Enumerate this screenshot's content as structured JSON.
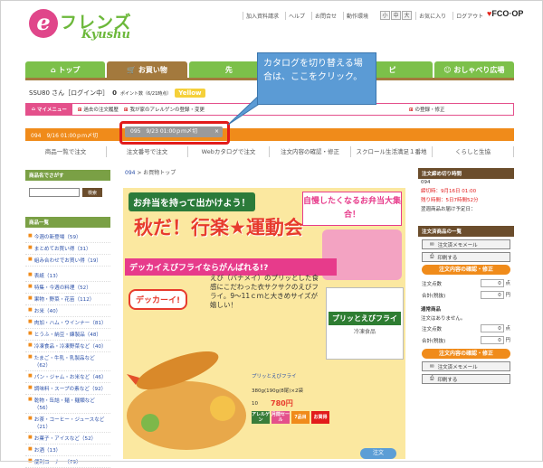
{
  "header": {
    "logo_e": "e",
    "logo_friends": "フレンズ",
    "logo_region": "Kyushu",
    "links": [
      "加入資料請求",
      "ヘルプ",
      "お問合せ",
      "動作環境"
    ],
    "font_sizes": [
      "小",
      "中",
      "大"
    ],
    "favorites": "お気に入り",
    "logout": "ログアウト",
    "coop_heart": "♥",
    "coop": "FCO·OP"
  },
  "nav": {
    "tabs": [
      {
        "label": "トップ",
        "icon": "house-icon"
      },
      {
        "label": "お買い物",
        "icon": "cart-icon"
      },
      {
        "label": "先",
        "icon": "runner-icon"
      },
      {
        "label": "",
        "icon": ""
      },
      {
        "label": "ピ",
        "icon": ""
      },
      {
        "label": "おしゃべり広場",
        "icon": "chat-icon"
      }
    ]
  },
  "status": {
    "user": "SSU80 さん［ログイン中］",
    "points": "0",
    "points_note": "ポイント数（6/21時点）",
    "badge": "Yellow"
  },
  "mypage": {
    "label": "マイメニュー",
    "items": [
      "過去の注文履歴",
      "我が家のアレルゲンの登録・変更",
      "の登録・修正"
    ]
  },
  "order_tabs": {
    "tab1": "094　9/16 01:00ｐｍ〆切",
    "tab2": "095　9/23 01:00ｐｍ〆切",
    "tab2_close": "×"
  },
  "submenu": [
    "商品一覧で注文",
    "注文番号で注文",
    "Webカタログで注文",
    "注文内容の確認・修正",
    "スクロール生活満足１番地",
    "くらしと生協"
  ],
  "callout": "カタログを切り替える場合は、ここをクリック。",
  "left": {
    "search_header": "商品名でさがす",
    "search_button": "検索",
    "search_placeholder": "",
    "list_header": "商品一覧",
    "categories": [
      "今週の新登場（59）",
      "まとめてお買い得（31）",
      "組み合わせでお買い得（19）",
      "表紙（13）",
      "特集・今週の料理（52）",
      "果物・野菜・花苗（112）",
      "お米（40）",
      "肉加・ハム・ウインナー（81）",
      "とうふ・納豆・練製品（48）",
      "冷凍食品・冷凍野菜など（40）",
      "たまご・牛乳・乳製品など（62）",
      "パン・ジャム・お米など（46）",
      "調味料・スープの素など（92）",
      "乾物・缶詰・麺・麺類など（56）",
      "お茶・コーヒー・ジュースなど（21）",
      "お菓子・アイスなど（52）",
      "お酒（13）",
      "便利コーナー（79）"
    ]
  },
  "center": {
    "crumb_num": "094",
    "crumb_rest": "> お買物トップ",
    "banner_title": "お弁当を持って出かけよう！",
    "banner_main": "秋だ！行楽★運動会",
    "banner_sub": "自慢したくなるお弁当大集合！",
    "ribbon": "デッカイえびフライならがんばれる!?",
    "dekkai": "デッカーイ!",
    "desc": "えび（バナメイ）のプリッとした食感にこだわった衣サクサクのえびフライ。9～11ｃｍと大きめサイズが嬉しい！",
    "pack_title": "プリッとえびフライ",
    "pack_sub": "冷凍食品",
    "product_name": "プリッとえびフライ",
    "product_size": "380g(190g(8尾)×2袋",
    "product_code": "10",
    "product_price": "780円",
    "tags": [
      "アレルゲン",
      "月間セール",
      "7品目",
      "お買得"
    ],
    "add_button": "注文"
  },
  "right": {
    "deadline_header": "注文締め切り時間",
    "round": "094",
    "deadline": "締切時：9月16日 01:00",
    "remaining": "残り時間：5日7時間52分",
    "delivery": "翌週商品お届け予定日：",
    "list_header": "注文済商品の一覧",
    "mail_button": "注文済メモメール",
    "print_button": "印刷する",
    "confirm_button": "注文内容の確認・修正",
    "count_label": "注文点数",
    "count_value": "0",
    "count_unit": "点",
    "total_label": "合計(税抜)",
    "total_value": "0",
    "total_unit": "円",
    "regular_label": "通常商品",
    "regular_note": "注文はありません。",
    "count2_label": "注文点数",
    "count2_value": "0",
    "total2_label": "合計(税抜)",
    "total2_value": "0",
    "confirm_button2": "注文内容の確認・修正",
    "mail_button2": "注文済メモメール",
    "print_button2": "印刷する"
  },
  "colors": {
    "brand_green": "#7cc04a",
    "accent_pink": "#e4508b",
    "order_orange": "#f08b1a",
    "highlight_red": "#e21b1b",
    "callout_blue": "#5b9bd5"
  }
}
